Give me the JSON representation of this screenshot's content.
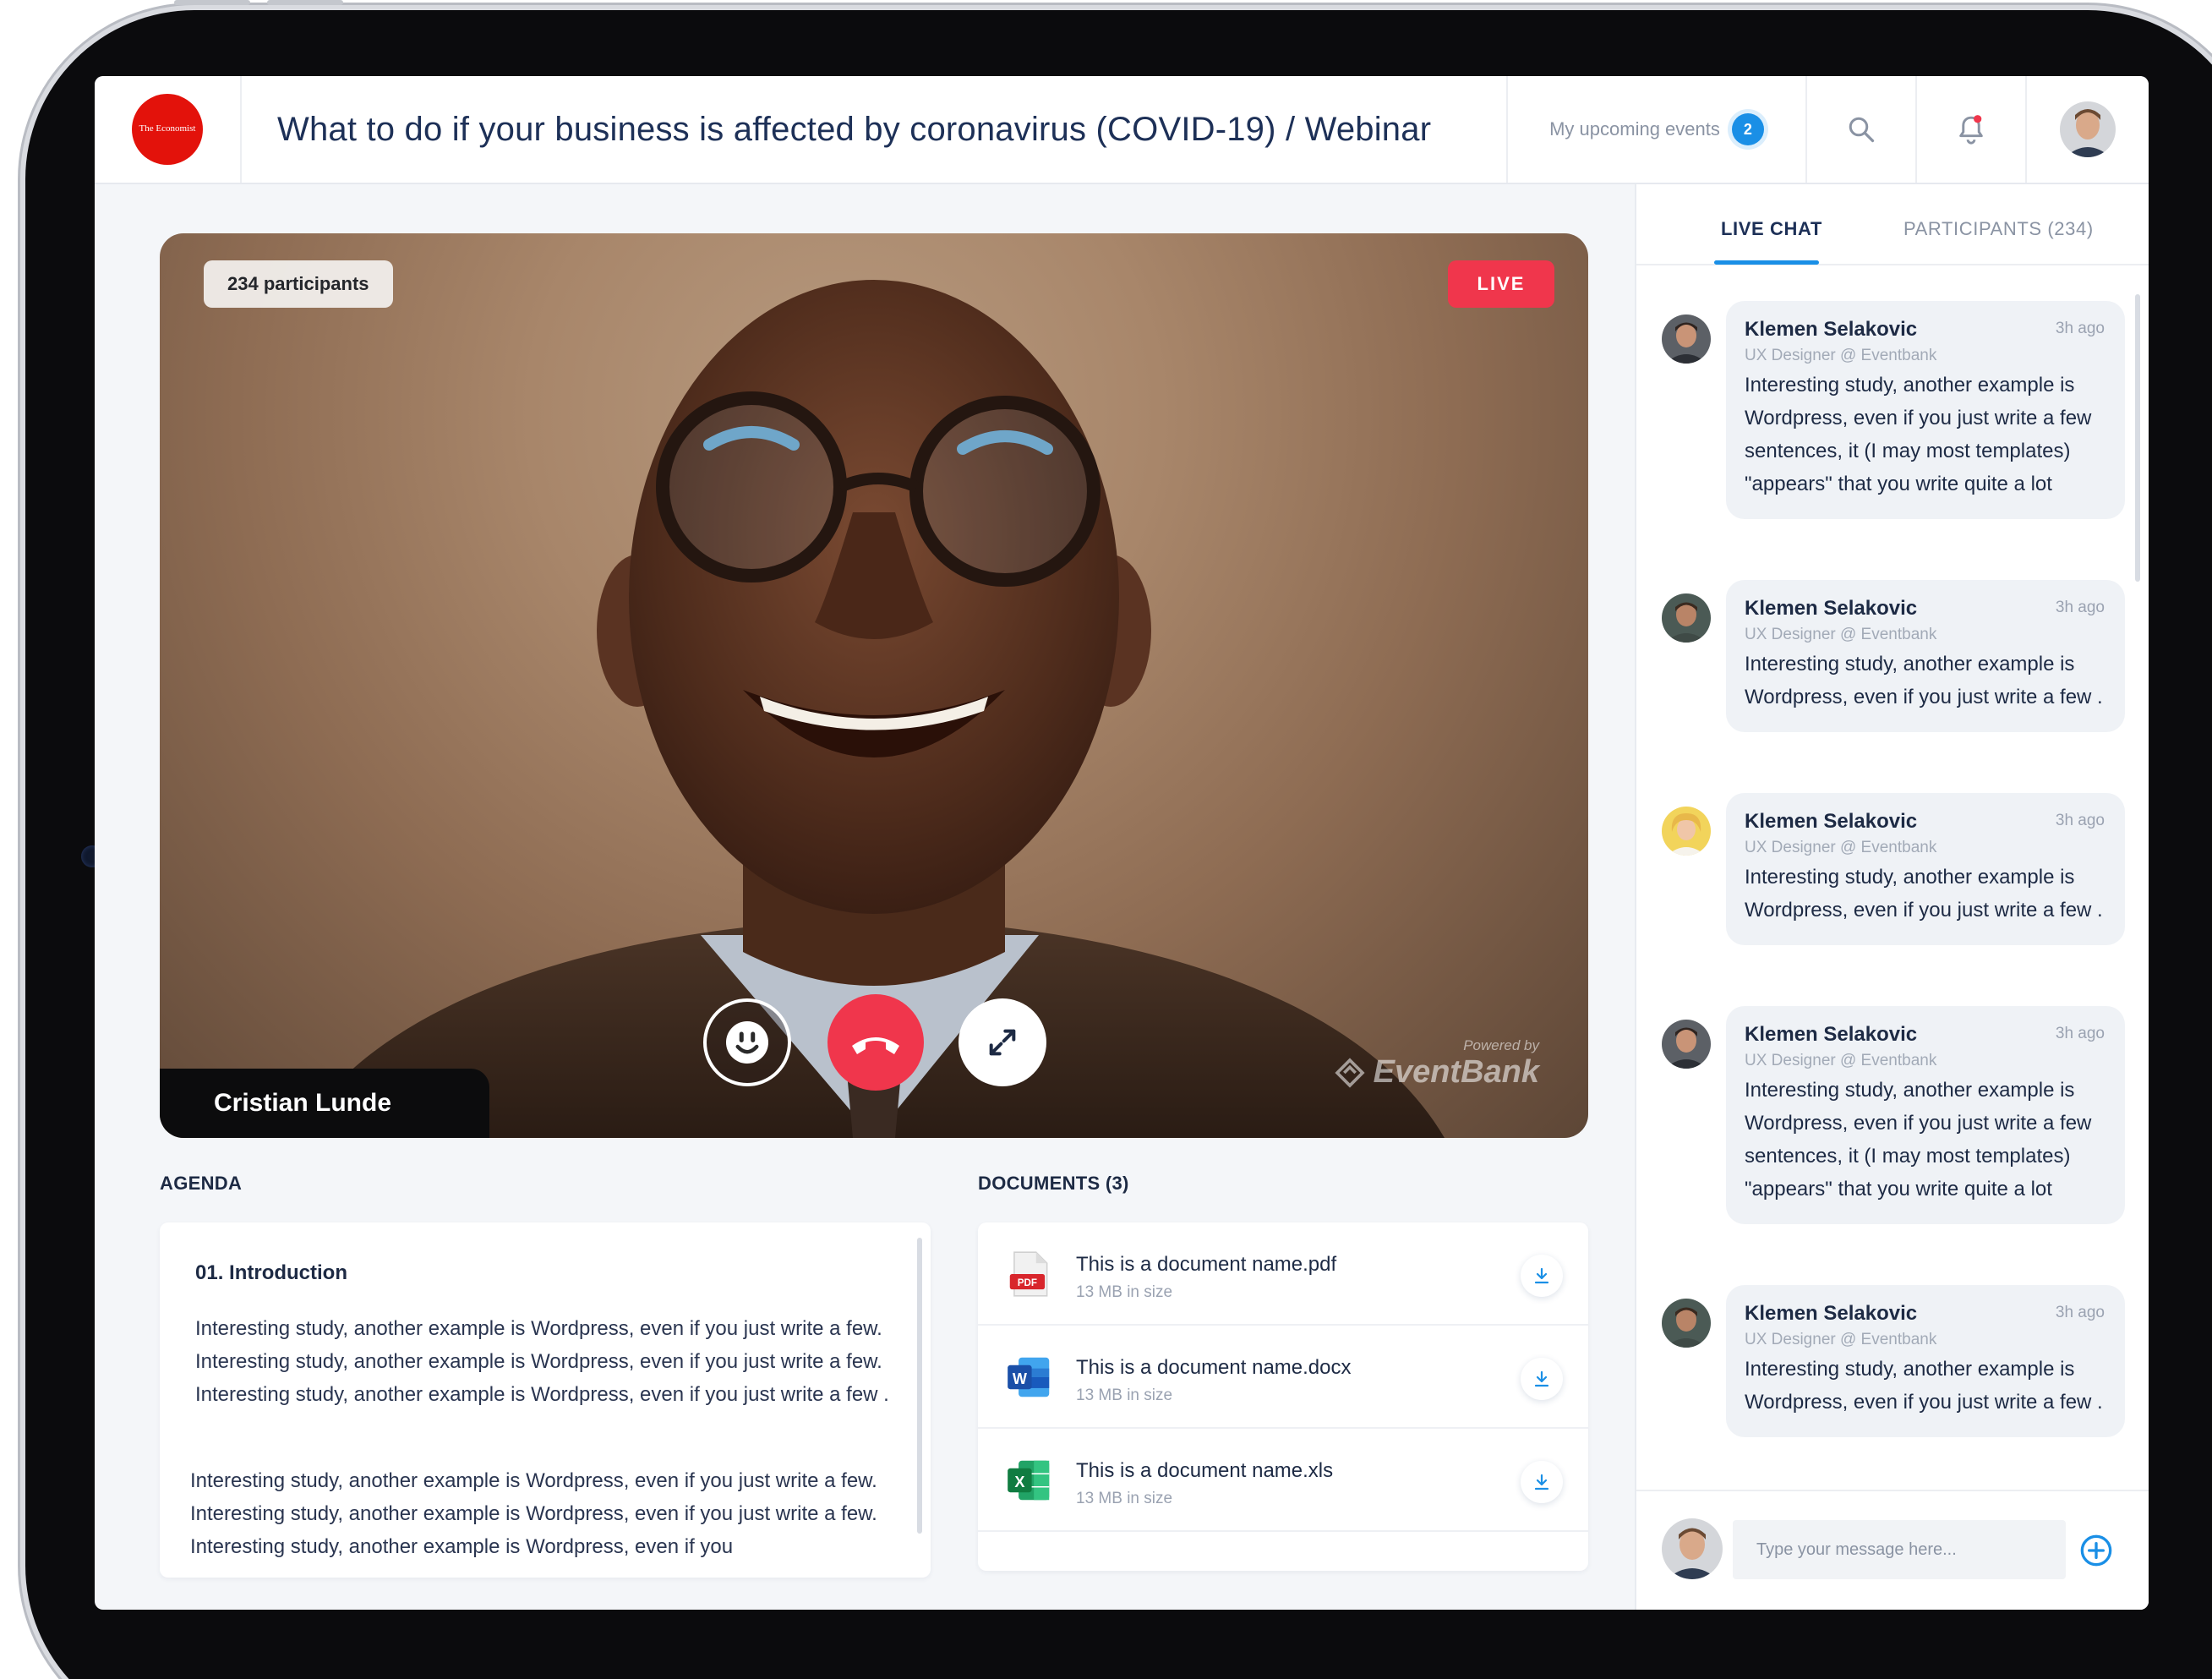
{
  "brand": {
    "logo_text": "The Economist"
  },
  "header": {
    "title": "What to do if your business is affected by coronavirus (COVID-19) / Webinar",
    "upcoming_label": "My upcoming events",
    "upcoming_count": "2"
  },
  "video": {
    "participants_label": "234 participants",
    "live_label": "LIVE",
    "speaker_name": "Cristian Lunde",
    "powered_by": "Powered by",
    "powered_brand": "EventBank"
  },
  "agenda": {
    "title": "AGENDA",
    "item_heading": "01. Introduction",
    "paragraph1": "Interesting study, another example is Wordpress, even if you just write a few. Interesting study, another example is Wordpress, even if you just write a few. Interesting study, another example is Wordpress, even if you just write a few .",
    "paragraph2": "Interesting study, another example is Wordpress, even if you just write a few. Interesting study, another example is Wordpress, even if you just write a few. Interesting study, another example is Wordpress, even if you"
  },
  "documents": {
    "title": "DOCUMENTS (3)",
    "items": [
      {
        "name": "This is a document name.pdf",
        "size": "13 MB in size",
        "icon": "pdf-file-icon",
        "icon_label": "PDF"
      },
      {
        "name": "This is a document name.docx",
        "size": "13 MB in size",
        "icon": "word-file-icon",
        "icon_label": "W"
      },
      {
        "name": "This is a document name.xls",
        "size": "13 MB in size",
        "icon": "excel-file-icon",
        "icon_label": "X"
      }
    ]
  },
  "panel": {
    "tabs": [
      {
        "label": "LIVE CHAT"
      },
      {
        "label": "PARTICIPANTS (234)"
      }
    ],
    "messages": [
      {
        "name": "Klemen Selakovic",
        "role": "UX Designer @ Eventbank",
        "time": "3h ago",
        "text": "Interesting study, another example is Wordpress, even if you just write a few sentences, it (I may most templates) \"appears\" that you write quite a lot"
      },
      {
        "name": "Klemen Selakovic",
        "role": "UX Designer @ Eventbank",
        "time": "3h ago",
        "text": "Interesting study, another example is Wordpress, even if you just write a few ."
      },
      {
        "name": "Klemen Selakovic",
        "role": "UX Designer @ Eventbank",
        "time": "3h ago",
        "text": "Interesting study, another example is Wordpress, even if you just write a few ."
      },
      {
        "name": "Klemen Selakovic",
        "role": "UX Designer @ Eventbank",
        "time": "3h ago",
        "text": "Interesting study, another example is Wordpress, even if you just write a few sentences, it (I may most templates) \"appears\" that you write quite a lot"
      },
      {
        "name": "Klemen Selakovic",
        "role": "UX Designer @ Eventbank",
        "time": "3h ago",
        "text": "Interesting study, another example is Wordpress, even if you just write a few ."
      }
    ],
    "composer_placeholder": "Type your message here..."
  },
  "colors": {
    "accent": "#1a8fe6",
    "live": "#f0364c",
    "brand": "#e3120b",
    "title": "#1d3057"
  }
}
